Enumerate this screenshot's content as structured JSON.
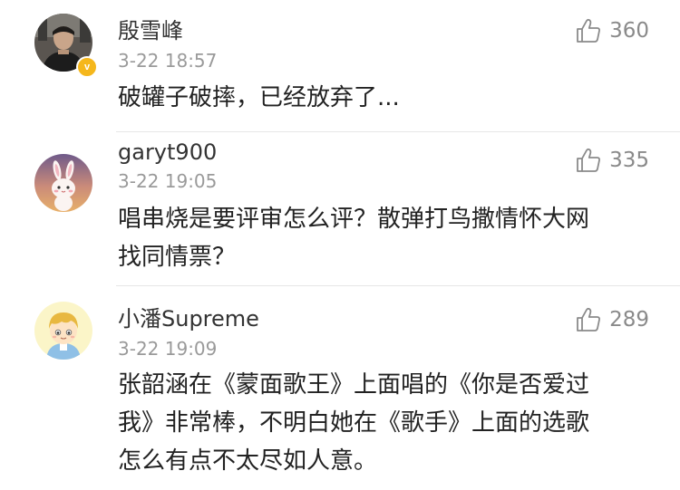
{
  "comments": [
    {
      "username": "殷雪峰",
      "timestamp": "3-22 18:57",
      "likes": "360",
      "verified_badge": "v",
      "avatar_icon": "user-photo-avatar",
      "content_lines": [
        "破罐子破摔，已经放弃了..."
      ]
    },
    {
      "username": "garyt900",
      "timestamp": "3-22 19:05",
      "likes": "335",
      "avatar_icon": "bunny-avatar",
      "content_lines": [
        "唱串烧是要评审怎么评？散弹打鸟撒情怀大网",
        "找同情票？"
      ]
    },
    {
      "username": "小潘Supreme",
      "timestamp": "3-22 19:09",
      "likes": "289",
      "avatar_icon": "cartoon-boy-avatar",
      "content_lines": [
        "张韶涵在《蒙面歌王》上面唱的《你是否爱过",
        "我》非常棒，不明白她在《歌手》上面的选歌",
        "怎么有点不太尽如人意。"
      ]
    }
  ],
  "colors": {
    "username": "#333333",
    "timestamp": "#9a9a9a",
    "like_count": "#8a8a8a",
    "content": "#222222",
    "divider": "#e6e6e6",
    "verified_badge": "#f5b71c"
  }
}
